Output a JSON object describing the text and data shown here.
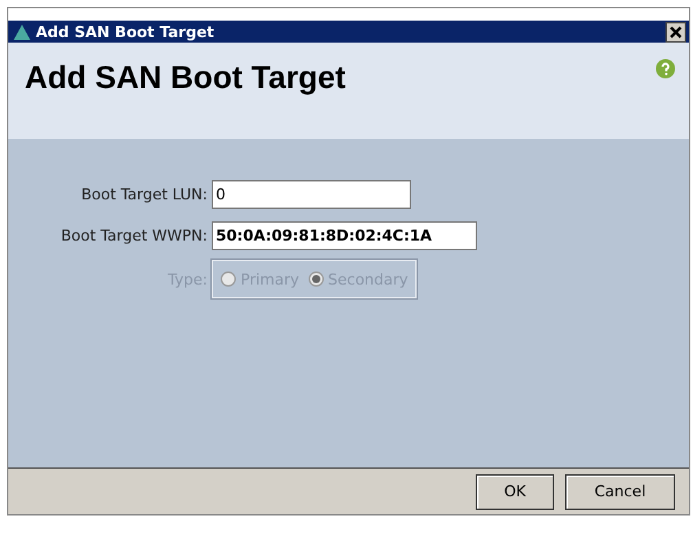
{
  "window": {
    "title": "Add SAN Boot Target"
  },
  "header": {
    "title": "Add SAN Boot Target"
  },
  "fields": [
    {
      "label": "Boot Target LUN:",
      "value": "0",
      "bold": false
    },
    {
      "label": "Boot Target WWPN:",
      "value": "50:0A:09:81:8D:02:4C:1A",
      "bold": true
    }
  ],
  "type": {
    "label": "Type:",
    "disabled": true,
    "options": [
      {
        "label": "Primary",
        "selected": false
      },
      {
        "label": "Secondary",
        "selected": true
      }
    ]
  },
  "buttons": [
    "OK",
    "Cancel"
  ]
}
